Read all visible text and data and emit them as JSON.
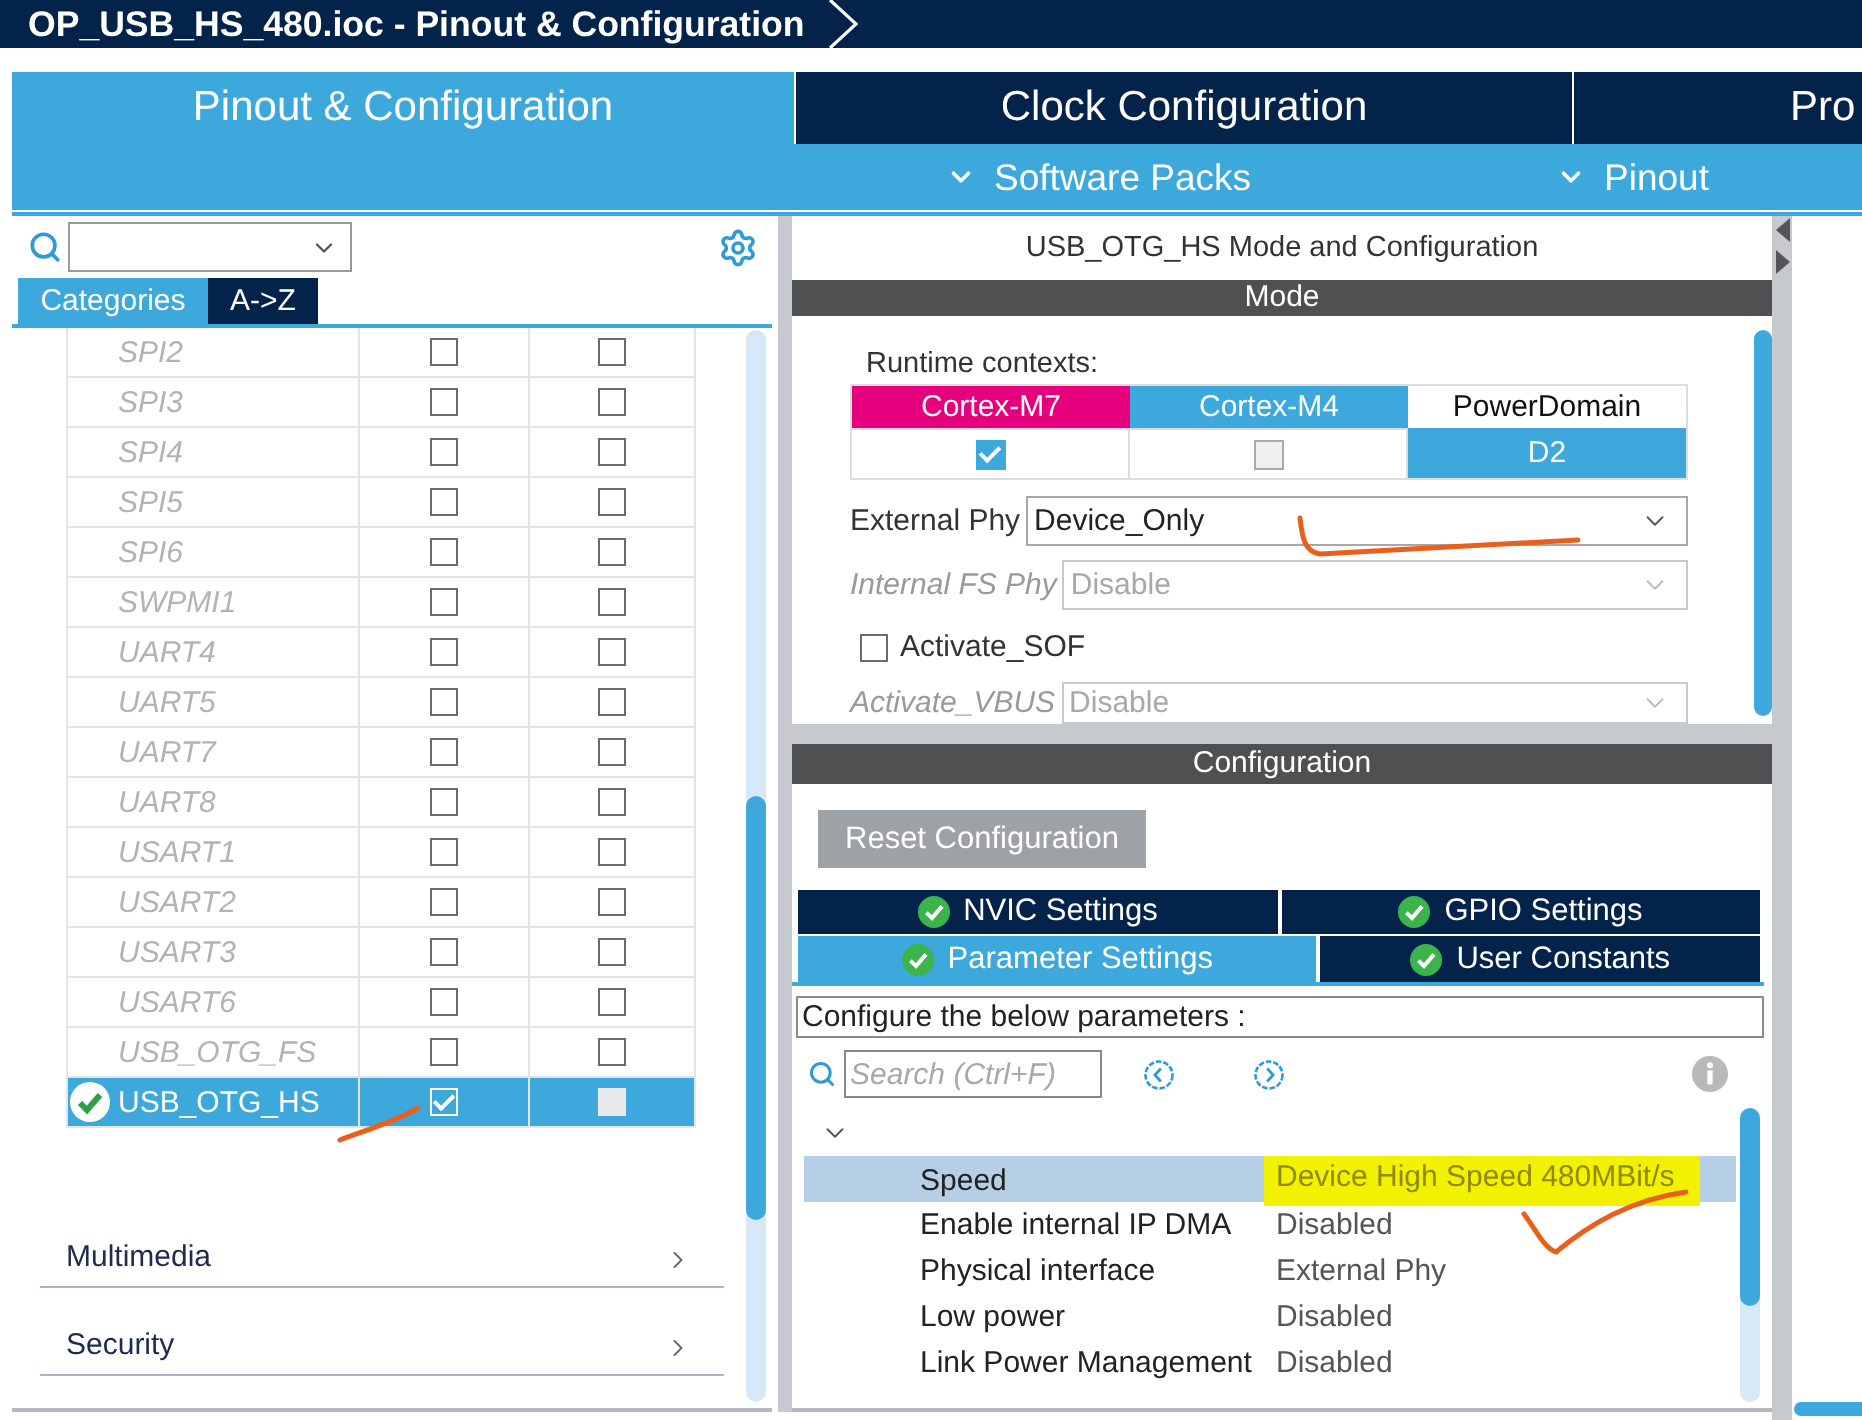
{
  "window": {
    "title": "OP_USB_HS_480.ioc - Pinout & Configuration"
  },
  "main_tabs": [
    {
      "label": "Pinout & Configuration",
      "selected": true
    },
    {
      "label": "Clock Configuration",
      "selected": false
    },
    {
      "label": "Pro",
      "selected": false
    }
  ],
  "sub_menu": [
    {
      "label": "Software Packs"
    },
    {
      "label": "Pinout"
    }
  ],
  "left_panel": {
    "view_tabs": [
      {
        "label": "Categories",
        "selected": true
      },
      {
        "label": "A->Z",
        "selected": false
      }
    ],
    "peripherals": [
      {
        "name": "SPI2",
        "configured": false,
        "selected": false,
        "column_2_checked": false,
        "column_3_checked": false
      },
      {
        "name": "SPI3",
        "configured": false,
        "selected": false,
        "column_2_checked": false,
        "column_3_checked": false
      },
      {
        "name": "SPI4",
        "configured": false,
        "selected": false,
        "column_2_checked": false,
        "column_3_checked": false
      },
      {
        "name": "SPI5",
        "configured": false,
        "selected": false,
        "column_2_checked": false,
        "column_3_checked": false
      },
      {
        "name": "SPI6",
        "configured": false,
        "selected": false,
        "column_2_checked": false,
        "column_3_checked": false
      },
      {
        "name": "SWPMI1",
        "configured": false,
        "selected": false,
        "column_2_checked": false,
        "column_3_checked": false
      },
      {
        "name": "UART4",
        "configured": false,
        "selected": false,
        "column_2_checked": false,
        "column_3_checked": false
      },
      {
        "name": "UART5",
        "configured": false,
        "selected": false,
        "column_2_checked": false,
        "column_3_checked": false
      },
      {
        "name": "UART7",
        "configured": false,
        "selected": false,
        "column_2_checked": false,
        "column_3_checked": false
      },
      {
        "name": "UART8",
        "configured": false,
        "selected": false,
        "column_2_checked": false,
        "column_3_checked": false
      },
      {
        "name": "USART1",
        "configured": false,
        "selected": false,
        "column_2_checked": false,
        "column_3_checked": false
      },
      {
        "name": "USART2",
        "configured": false,
        "selected": false,
        "column_2_checked": false,
        "column_3_checked": false
      },
      {
        "name": "USART3",
        "configured": false,
        "selected": false,
        "column_2_checked": false,
        "column_3_checked": false
      },
      {
        "name": "USART6",
        "configured": false,
        "selected": false,
        "column_2_checked": false,
        "column_3_checked": false
      },
      {
        "name": "USB_OTG_FS",
        "configured": false,
        "selected": false,
        "column_2_checked": false,
        "column_3_checked": false
      },
      {
        "name": "USB_OTG_HS",
        "configured": true,
        "selected": true,
        "column_2_checked": true,
        "column_3_checked": false
      }
    ],
    "categories": [
      {
        "label": "Multimedia",
        "expanded": false
      },
      {
        "label": "Security",
        "expanded": false
      }
    ]
  },
  "mode_panel": {
    "title": "USB_OTG_HS Mode and Configuration",
    "header": "Mode",
    "runtime_label": "Runtime contexts:",
    "contexts": [
      {
        "kind": "core",
        "name": "Cortex-M7",
        "color": "#e6007e",
        "checked": true,
        "disabled": false
      },
      {
        "kind": "core",
        "name": "Cortex-M4",
        "color": "#3ca8dc",
        "checked": false,
        "disabled": true
      },
      {
        "kind": "domain",
        "name": "PowerDomain",
        "color": "#ffffff",
        "value": "D2"
      }
    ],
    "fields": [
      {
        "kind": "select",
        "label": "External Phy",
        "value": "Device_Only",
        "disabled": false
      },
      {
        "kind": "select",
        "label": "Internal FS Phy",
        "value": "Disable",
        "disabled": true
      },
      {
        "kind": "checkbox",
        "label": "Activate_SOF",
        "checked": false
      },
      {
        "kind": "select",
        "label": "Activate_VBUS",
        "value": "Disable",
        "disabled": true
      }
    ]
  },
  "configuration": {
    "header": "Configuration",
    "reset_button": "Reset Configuration",
    "tabs": [
      {
        "label": "NVIC Settings",
        "selected": false,
        "valid": true
      },
      {
        "label": "GPIO Settings",
        "selected": false,
        "valid": true
      },
      {
        "label": "Parameter Settings",
        "selected": true,
        "valid": true
      },
      {
        "label": "User Constants",
        "selected": false,
        "valid": true
      }
    ],
    "description": "Configure the below parameters :",
    "search": {
      "placeholder": "Search (Ctrl+F)"
    },
    "group_expanded": true,
    "parameters": [
      {
        "name": "Speed",
        "value": "Device High Speed 480MBit/s",
        "selected": true,
        "highlighted": true
      },
      {
        "name": "Enable internal IP DMA",
        "value": "Disabled",
        "selected": false,
        "highlighted": false
      },
      {
        "name": "Physical interface",
        "value": "External Phy",
        "selected": false,
        "highlighted": false
      },
      {
        "name": "Low power",
        "value": "Disabled",
        "selected": false,
        "highlighted": false
      },
      {
        "name": "Link Power Management",
        "value": "Disabled",
        "selected": false,
        "highlighted": false
      }
    ]
  }
}
